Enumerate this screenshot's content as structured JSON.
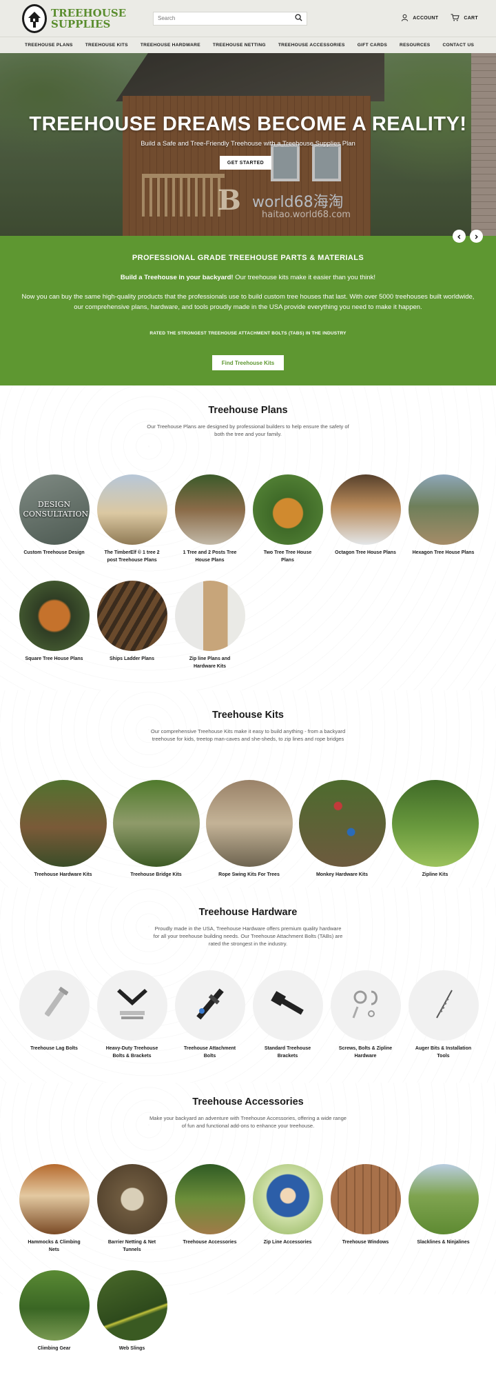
{
  "header": {
    "logo_text_line1": "TREEHOUSE",
    "logo_text_line2": "SUPPLIES",
    "search_placeholder": "Search",
    "account_label": "ACCOUNT",
    "cart_label": "CART"
  },
  "nav": [
    "TREEHOUSE PLANS",
    "TREEHOUSE KITS",
    "TREEHOUSE HARDWARE",
    "TREEHOUSE NETTING",
    "TREEHOUSE ACCESSORIES",
    "GIFT CARDS",
    "RESOURCES",
    "CONTACT US"
  ],
  "hero": {
    "title": "TREEHOUSE DREAMS BECOME A REALITY!",
    "subtitle": "Build a Safe and Tree-Friendly Treehouse with a Treehouse Supplies Plan",
    "button": "GET STARTED",
    "watermark": "world68海淘",
    "watermark_url": "haitao.world68.com"
  },
  "green_band": {
    "heading": "PROFESSIONAL GRADE TREEHOUSE PARTS & MATERIALS",
    "lead_bold": "Build a Treehouse in your backyard!",
    "lead_rest": " Our treehouse kits make it easier than you think!",
    "paragraph": "Now you can buy the same high-quality products that the professionals use to build custom tree houses that last. With over 5000 treehouses built worldwide, our comprehensive plans, hardware, and tools proudly made in the USA provide everything you need to make it happen.",
    "rated": "RATED THE STRONGEST TREEHOUSE ATTACHMENT BOLTS (TABS) IN THE INDUSTRY",
    "button": "Find Treehouse Kits"
  },
  "plans": {
    "title": "Treehouse Plans",
    "description": "Our Treehouse Plans are designed by professional builders to help ensure the safety of both the tree and your family.",
    "design_overlay": "DESIGN CONSULTATION",
    "items": [
      "Custom Treehouse Design",
      "The TimberElf © 1 tree 2 post Treehouse Plans",
      "1 Tree and 2 Posts Tree House Plans",
      "Two Tree Tree House Plans",
      "Octagon Tree House Plans",
      "Hexagon Tree House Plans",
      "Square Tree House Plans",
      "Ships Ladder Plans",
      "Zip line Plans and Hardware Kits"
    ]
  },
  "kits": {
    "title": "Treehouse Kits",
    "description": "Our comprehensive Treehouse Kits make it easy to build anything - from a backyard treehouse for kids, treetop man-caves and she-sheds, to zip lines and rope bridges",
    "items": [
      "Treehouse Hardware Kits",
      "Treehouse Bridge Kits",
      "Rope Swing Kits For Trees",
      "Monkey Hardware Kits",
      "Zipline Kits"
    ]
  },
  "hardware": {
    "title": "Treehouse Hardware",
    "description": "Proudly made in the USA, Treehouse Hardware offers premium quality hardware for all your treehouse building needs. Our Treehouse Attachment Bolts (TABs) are rated the strongest in the industry.",
    "items": [
      "Treehouse Lag Bolts",
      "Heavy-Duty Treehouse Bolts & Brackets",
      "Treehouse Attachment Bolts",
      "Standard Treehouse Brackets",
      "Screws, Bolts & Zipline Hardware",
      "Auger Bits & Installation Tools"
    ]
  },
  "accessories": {
    "title": "Treehouse Accessories",
    "description": "Make your backyard an adventure with Treehouse Accessories, offering a wide range of fun and functional add-ons to enhance your treehouse.",
    "items": [
      "Hammocks & Climbing Nets",
      "Barrier Netting & Net Tunnels",
      "Treehouse Accessories",
      "Zip Line Accessories",
      "Treehouse Windows",
      "Slacklines & Ninjalines",
      "Climbing Gear",
      "Web Slings"
    ]
  },
  "colors": {
    "brand_green": "#5e9731",
    "header_bg": "#ebebe6"
  }
}
